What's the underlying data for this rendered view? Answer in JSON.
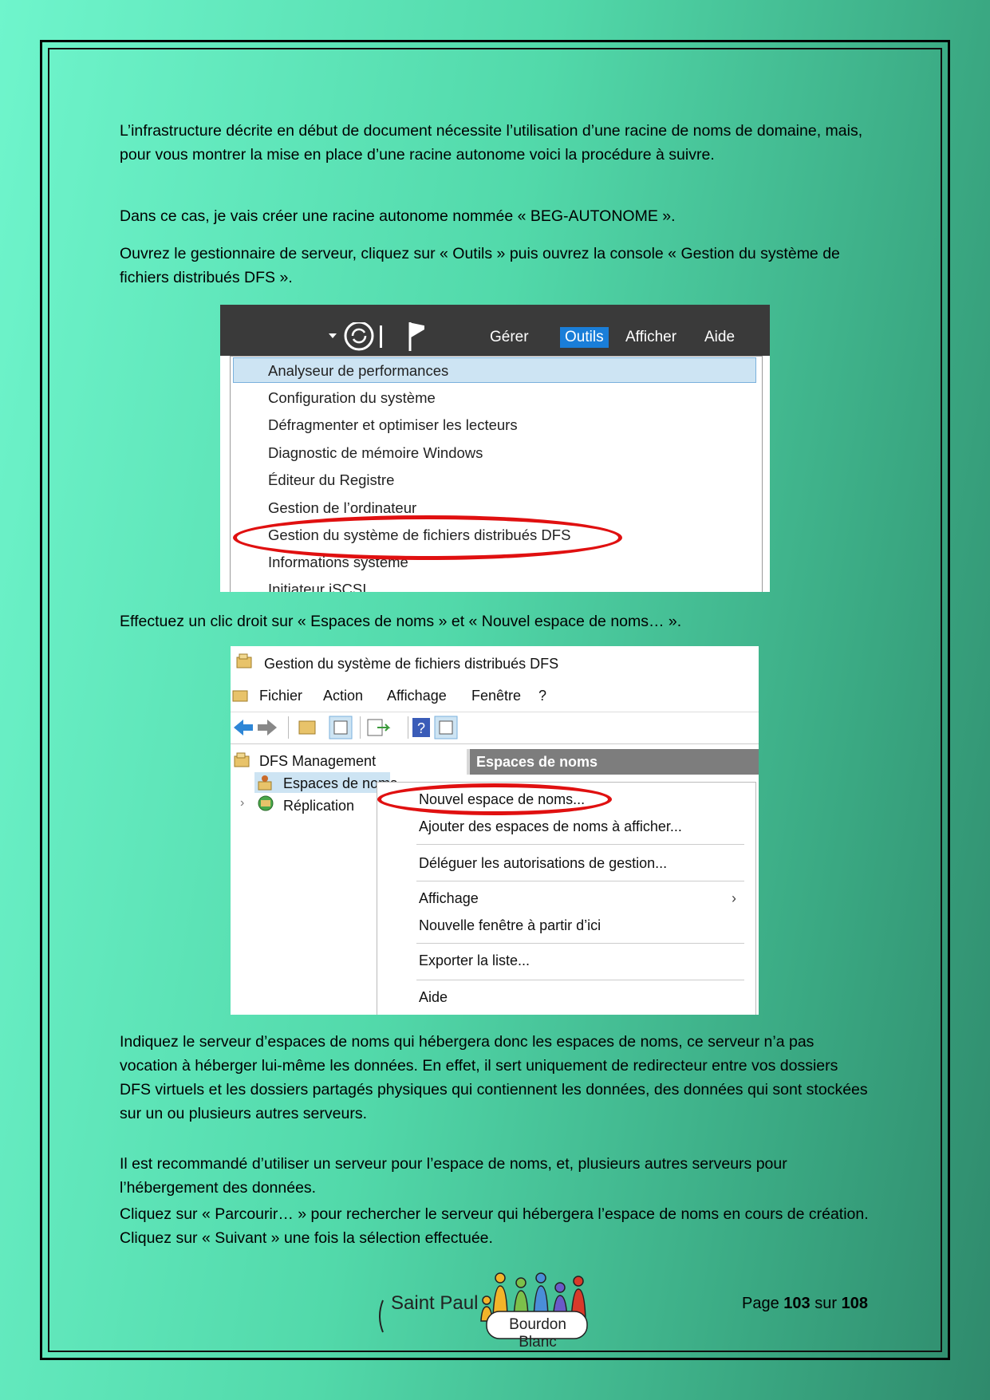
{
  "paragraphs": [
    "L’infrastructure décrite en début de document nécessite l’utilisation d’une racine de noms de domaine, mais, pour vous montrer la mise en place d’une racine autonome voici la procédure à suivre.",
    "Dans ce cas, je vais créer une racine autonome nommée « BEG-AUTONOME ».",
    "Ouvrez le gestionnaire de serveur, cliquez sur « Outils » puis ouvrez la console « Gestion du système de fichiers distribués DFS ».",
    "Effectuez un clic droit sur « Espaces de noms » et « Nouvel espace de noms… ».",
    "Indiquez le serveur d’espaces de noms qui hébergera donc les espaces de noms, ce serveur n’a pas vocation à héberger lui-même les données. En effet, il sert uniquement de redirecteur entre vos dossiers DFS virtuels et les dossiers partagés physiques qui contiennent les données, des données qui sont stockées sur un ou plusieurs autres serveurs.",
    "Il est recommandé d’utiliser un serveur pour l’espace de noms, et, plusieurs autres serveurs pour l’hébergement des données.",
    "Cliquez sur « Parcourir… » pour rechercher le serveur qui hébergera l’espace de noms en cours de création. Cliquez sur « Suivant » une fois la sélection effectuée."
  ],
  "screenshot1": {
    "menubar": [
      "Gérer",
      "Outils",
      "Afficher",
      "Aide"
    ],
    "selected_menu": "Outils",
    "items": [
      "Analyseur de performances",
      "Configuration du système",
      "Défragmenter et optimiser les lecteurs",
      "Diagnostic de mémoire Windows",
      "Éditeur du Registre",
      "Gestion de l’ordinateur",
      "Gestion du système de fichiers distribués DFS",
      "Informations système",
      "Initiateur iSCSI"
    ]
  },
  "screenshot2": {
    "window_title": "Gestion du système de fichiers distribués DFS",
    "menus": [
      "Fichier",
      "Action",
      "Affichage",
      "Fenêtre",
      "?"
    ],
    "tree": [
      "DFS Management",
      "Espaces de noms",
      "Réplication"
    ],
    "pane_header": "Espaces de noms",
    "context_menu": [
      "Nouvel espace de noms...",
      "Ajouter des espaces de noms à afficher...",
      "Déléguer les autorisations de gestion...",
      "Affichage",
      "Nouvelle fenêtre à partir d’ici",
      "Exporter la liste...",
      "Aide"
    ]
  },
  "footer": {
    "logo_text_1": "Saint Paul",
    "logo_text_2": "Bourdon Blanc",
    "page_label": "Page",
    "page_current": "103",
    "page_sep": "sur",
    "page_total": "108"
  },
  "colors": {
    "highlight_circle": "#e01010",
    "menu_selected": "#1a7ed8"
  }
}
